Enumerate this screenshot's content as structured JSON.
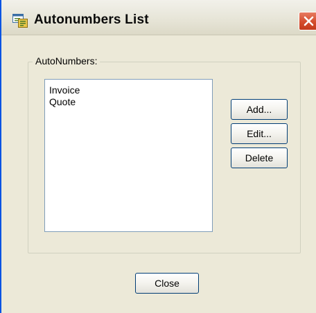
{
  "window": {
    "title": "Autonumbers List",
    "app_icon": "autonumbers-app-icon",
    "close_icon": "close-icon"
  },
  "group": {
    "label": "AutoNumbers:"
  },
  "list": {
    "items": [
      "Invoice",
      "Quote"
    ]
  },
  "buttons": {
    "add": "Add...",
    "edit": "Edit...",
    "delete": "Delete",
    "close": "Close"
  },
  "colors": {
    "window_bg": "#ece9d8",
    "close_button": "#d44d2d",
    "list_border": "#7f9db9",
    "button_border": "#003c74"
  }
}
